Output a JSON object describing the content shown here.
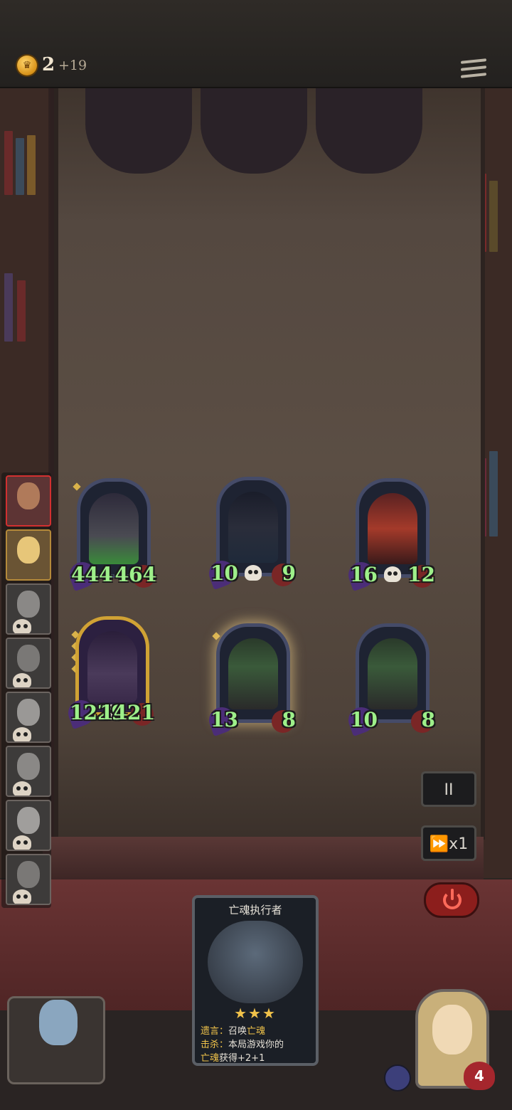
{
  "topbar": {
    "gold_amount": "2",
    "gold_income": "+19",
    "coin_icon": "crown-coin-icon",
    "menu_icon": "hamburger-menu-icon"
  },
  "lineup": [
    {
      "name": "player-1",
      "state": "active"
    },
    {
      "name": "player-2",
      "state": "ally"
    },
    {
      "name": "player-3",
      "state": "eliminated"
    },
    {
      "name": "player-4",
      "state": "eliminated"
    },
    {
      "name": "player-5",
      "state": "eliminated"
    },
    {
      "name": "player-6",
      "state": "eliminated"
    },
    {
      "name": "player-7",
      "state": "eliminated"
    },
    {
      "name": "player-8",
      "state": "eliminated"
    }
  ],
  "board": {
    "units": [
      {
        "atk": "444",
        "hp": "464"
      },
      {
        "atk": "10",
        "hp": "9"
      },
      {
        "atk": "16",
        "hp": "12"
      },
      {
        "atk": "1229",
        "hp": "1421"
      },
      {
        "atk": "13",
        "hp": "8"
      },
      {
        "atk": "10",
        "hp": "8"
      }
    ]
  },
  "controls": {
    "pause_label": "II",
    "speed_label": "⏩x1",
    "power_icon": "power-icon"
  },
  "card": {
    "title": "亡魂执行者",
    "stars": "★★★",
    "line1_key": "遗言：",
    "line1_text": "召唤",
    "line1_highlight": "亡魂",
    "line2_key": "击杀：",
    "line2_text": "本局游戏你的",
    "line3_highlight": "亡魂",
    "line3_text": "获得+2+1"
  },
  "hero": {
    "health": "4"
  }
}
